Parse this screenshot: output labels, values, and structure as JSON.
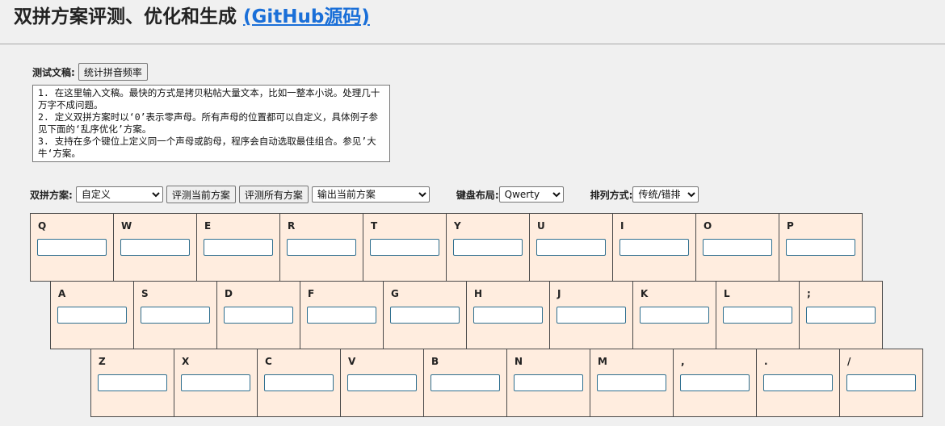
{
  "header": {
    "title": "双拼方案评测、优化和生成",
    "link_label": "(GitHub源码)"
  },
  "corpus": {
    "label": "测试文稿:",
    "stats_button": "统计拼音频率",
    "text": "1. 在这里输入文稿。最快的方式是拷贝粘帖大量文本，比如一整本小说。处理几十万字不成问题。\n2. 定义双拼方案时以‘0’表示零声母。所有声母的位置都可以自定义，具体例子参见下面的‘乱序优化’方案。\n3. 支持在多个键位上定义同一个声母或韵母，程序会自动选取最佳组合。参见’大牛‘方案。"
  },
  "controls": {
    "scheme_label": "双拼方案:",
    "scheme_value": "自定义",
    "eval_current": "评测当前方案",
    "eval_all": "评测所有方案",
    "output_value": "输出当前方案",
    "layout_label": "键盘布局:",
    "layout_value": "Qwerty",
    "arrange_label": "排列方式:",
    "arrange_value": "传统/错排"
  },
  "keyboard": {
    "rows": [
      [
        "Q",
        "W",
        "E",
        "R",
        "T",
        "Y",
        "U",
        "I",
        "O",
        "P"
      ],
      [
        "A",
        "S",
        "D",
        "F",
        "G",
        "H",
        "J",
        "K",
        "L",
        ";"
      ],
      [
        "Z",
        "X",
        "C",
        "V",
        "B",
        "N",
        "M",
        ",",
        ".",
        "/"
      ]
    ]
  },
  "colors": {
    "key_bg": "#ffeddf",
    "link": "#1a6fd8"
  }
}
